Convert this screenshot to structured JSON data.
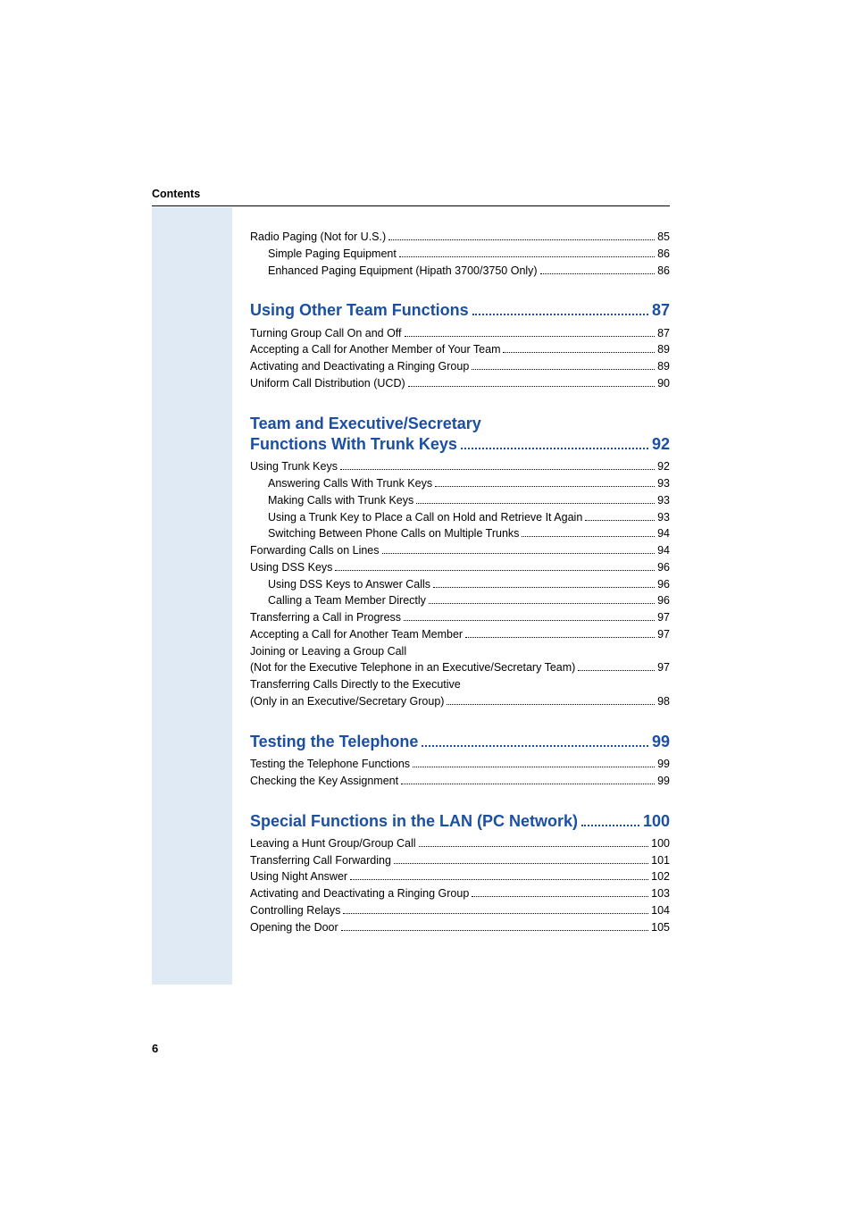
{
  "header": {
    "title": "Contents"
  },
  "footer": {
    "page_number": "6"
  },
  "pre_entries": [
    {
      "label": "Radio Paging (Not for U.S.)",
      "page": "85",
      "indent": 0
    },
    {
      "label": "Simple Paging Equipment",
      "page": "86",
      "indent": 1
    },
    {
      "label": "Enhanced Paging Equipment (Hipath 3700/3750 Only)",
      "page": "86",
      "indent": 1
    }
  ],
  "sections": [
    {
      "title": "Using Other Team Functions",
      "page": "87",
      "entries": [
        {
          "label": "Turning Group Call On and Off",
          "page": "87",
          "indent": 0
        },
        {
          "label": "Accepting a Call for Another Member of Your Team",
          "page": "89",
          "indent": 0
        },
        {
          "label": "Activating and Deactivating a Ringing Group",
          "page": "89",
          "indent": 0
        },
        {
          "label": "Uniform Call Distribution (UCD)",
          "page": "90",
          "indent": 0
        }
      ]
    },
    {
      "title_line1": "Team and Executive/Secretary",
      "title_line2": "Functions With Trunk Keys",
      "page": "92",
      "entries": [
        {
          "label": "Using Trunk Keys",
          "page": "92",
          "indent": 0
        },
        {
          "label": "Answering Calls With Trunk Keys",
          "page": "93",
          "indent": 1
        },
        {
          "label": "Making Calls with Trunk Keys",
          "page": "93",
          "indent": 1
        },
        {
          "label": "Using a Trunk Key to Place a Call on Hold and Retrieve It Again",
          "page": "93",
          "indent": 1
        },
        {
          "label": "Switching Between Phone Calls on Multiple Trunks",
          "page": "94",
          "indent": 1
        },
        {
          "label": "Forwarding Calls on Lines",
          "page": "94",
          "indent": 0
        },
        {
          "label": "Using DSS Keys",
          "page": "96",
          "indent": 0
        },
        {
          "label": "Using DSS Keys to Answer Calls",
          "page": "96",
          "indent": 1
        },
        {
          "label": "Calling a Team Member Directly",
          "page": "96",
          "indent": 1
        },
        {
          "label": "Transferring a Call in Progress",
          "page": "97",
          "indent": 0
        },
        {
          "label": "Accepting a Call for Another Team Member",
          "page": "97",
          "indent": 0
        },
        {
          "pre_label": "Joining or Leaving a Group Call",
          "label": "(Not for the Executive Telephone in an Executive/Secretary Team)",
          "page": "97",
          "indent": 0
        },
        {
          "pre_label": "Transferring Calls Directly to the Executive",
          "label": "(Only in an Executive/Secretary Group)",
          "page": "98",
          "indent": 0
        }
      ]
    },
    {
      "title": "Testing the Telephone",
      "page": "99",
      "entries": [
        {
          "label": "Testing the Telephone Functions",
          "page": "99",
          "indent": 0
        },
        {
          "label": "Checking the Key Assignment",
          "page": "99",
          "indent": 0
        }
      ]
    },
    {
      "title": "Special Functions in the LAN (PC Network)",
      "page": "100",
      "entries": [
        {
          "label": "Leaving a Hunt Group/Group Call",
          "page": "100",
          "indent": 0
        },
        {
          "label": "Transferring Call Forwarding",
          "page": "101",
          "indent": 0
        },
        {
          "label": "Using Night Answer",
          "page": "102",
          "indent": 0
        },
        {
          "label": "Activating and Deactivating a Ringing Group",
          "page": "103",
          "indent": 0
        },
        {
          "label": "Controlling Relays",
          "page": "104",
          "indent": 0
        },
        {
          "label": "Opening the Door",
          "page": "105",
          "indent": 0
        }
      ]
    }
  ]
}
